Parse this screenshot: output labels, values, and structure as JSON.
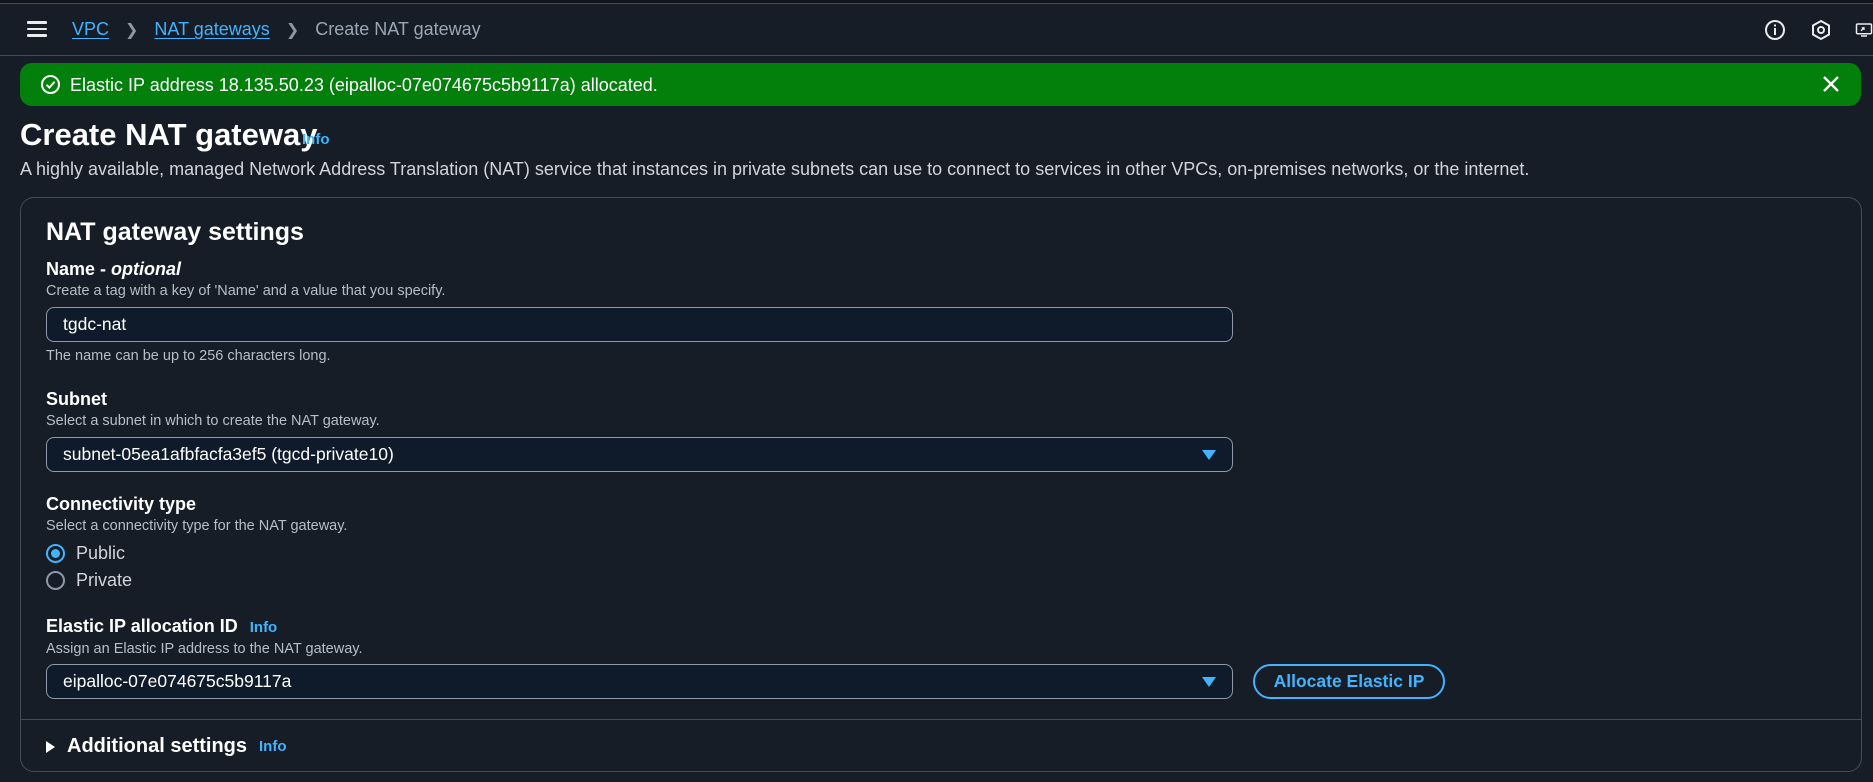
{
  "breadcrumb": {
    "items": [
      "VPC",
      "NAT gateways"
    ],
    "current": "Create NAT gateway"
  },
  "top_icons": [
    "info-circle-icon",
    "hexagon-settings-icon",
    "display-share-icon"
  ],
  "flash": {
    "message": "Elastic IP address 18.135.50.23 (eipalloc-07e074675c5b9117a) allocated.",
    "color": "#037f0c"
  },
  "page": {
    "title": "Create NAT gateway",
    "info": "Info",
    "description": "A highly available, managed Network Address Translation (NAT) service that instances in private subnets can use to connect to services in other VPCs, on-premises networks, or the internet."
  },
  "panel": {
    "title": "NAT gateway settings",
    "name": {
      "label": "Name - ",
      "label_optional": "optional",
      "description": "Create a tag with a key of 'Name' and a value that you specify.",
      "value": "tgdc-nat",
      "constraint": "The name can be up to 256 characters long."
    },
    "subnet": {
      "label": "Subnet",
      "description": "Select a subnet in which to create the NAT gateway.",
      "value": "subnet-05ea1afbfacfa3ef5 (tgcd-private10)"
    },
    "connectivity": {
      "label": "Connectivity type",
      "description": "Select a connectivity type for the NAT gateway.",
      "options": [
        "Public",
        "Private"
      ],
      "selected": "Public"
    },
    "eip": {
      "label": "Elastic IP allocation ID",
      "info": "Info",
      "description": "Assign an Elastic IP address to the NAT gateway.",
      "value": "eipalloc-07e074675c5b9117a",
      "button": "Allocate Elastic IP"
    },
    "additional": {
      "label": "Additional settings",
      "info": "Info"
    }
  },
  "colors": {
    "background": "#161d26",
    "accent": "#42b4ff",
    "success": "#037f0c",
    "border": "#414d5c"
  }
}
